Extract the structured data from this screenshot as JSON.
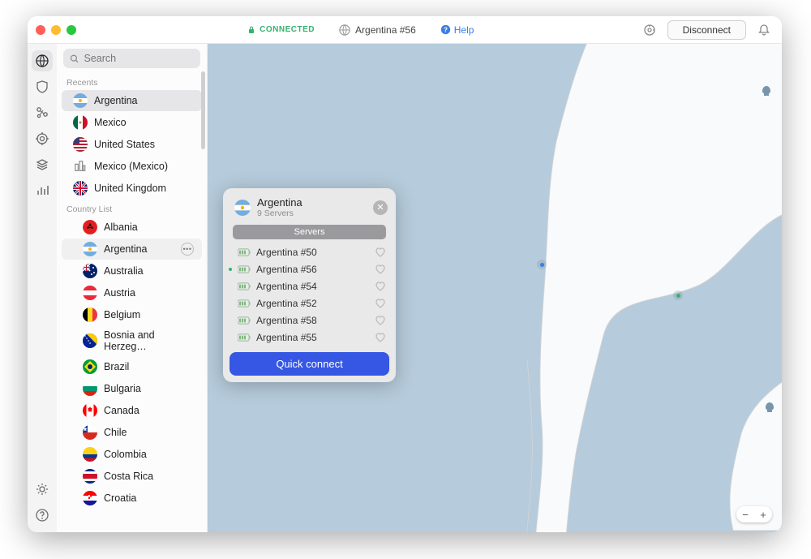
{
  "titlebar": {
    "status": "CONNECTED",
    "server": "Argentina #56",
    "help": "Help",
    "disconnect": "Disconnect"
  },
  "sidebar": {
    "search_placeholder": "Search",
    "section_recents": "Recents",
    "section_countries": "Country List",
    "recents": [
      {
        "label": "Argentina",
        "flag": "ar",
        "selected": true
      },
      {
        "label": "Mexico",
        "flag": "mx"
      },
      {
        "label": "United States",
        "flag": "us"
      },
      {
        "label": "Mexico (Mexico)",
        "flag": "city"
      },
      {
        "label": "United Kingdom",
        "flag": "uk"
      }
    ],
    "countries": [
      {
        "label": "Albania",
        "flag": "al"
      },
      {
        "label": "Argentina",
        "flag": "ar",
        "hovered": true,
        "more": true
      },
      {
        "label": "Australia",
        "flag": "au"
      },
      {
        "label": "Austria",
        "flag": "at"
      },
      {
        "label": "Belgium",
        "flag": "be"
      },
      {
        "label": "Bosnia and Herzeg…",
        "flag": "ba"
      },
      {
        "label": "Brazil",
        "flag": "br"
      },
      {
        "label": "Bulgaria",
        "flag": "bg"
      },
      {
        "label": "Canada",
        "flag": "ca"
      },
      {
        "label": "Chile",
        "flag": "cl"
      },
      {
        "label": "Colombia",
        "flag": "co"
      },
      {
        "label": "Costa Rica",
        "flag": "cr"
      },
      {
        "label": "Croatia",
        "flag": "hr"
      }
    ]
  },
  "popup": {
    "title": "Argentina",
    "subtitle": "9 Servers",
    "pill": "Servers",
    "quick": "Quick connect",
    "servers": [
      {
        "name": "Argentina #50",
        "active": false
      },
      {
        "name": "Argentina #56",
        "active": true
      },
      {
        "name": "Argentina #54",
        "active": false
      },
      {
        "name": "Argentina #52",
        "active": false
      },
      {
        "name": "Argentina #58",
        "active": false
      },
      {
        "name": "Argentina #55",
        "active": false
      }
    ]
  },
  "zoom": {
    "minus": "−",
    "plus": "+"
  }
}
